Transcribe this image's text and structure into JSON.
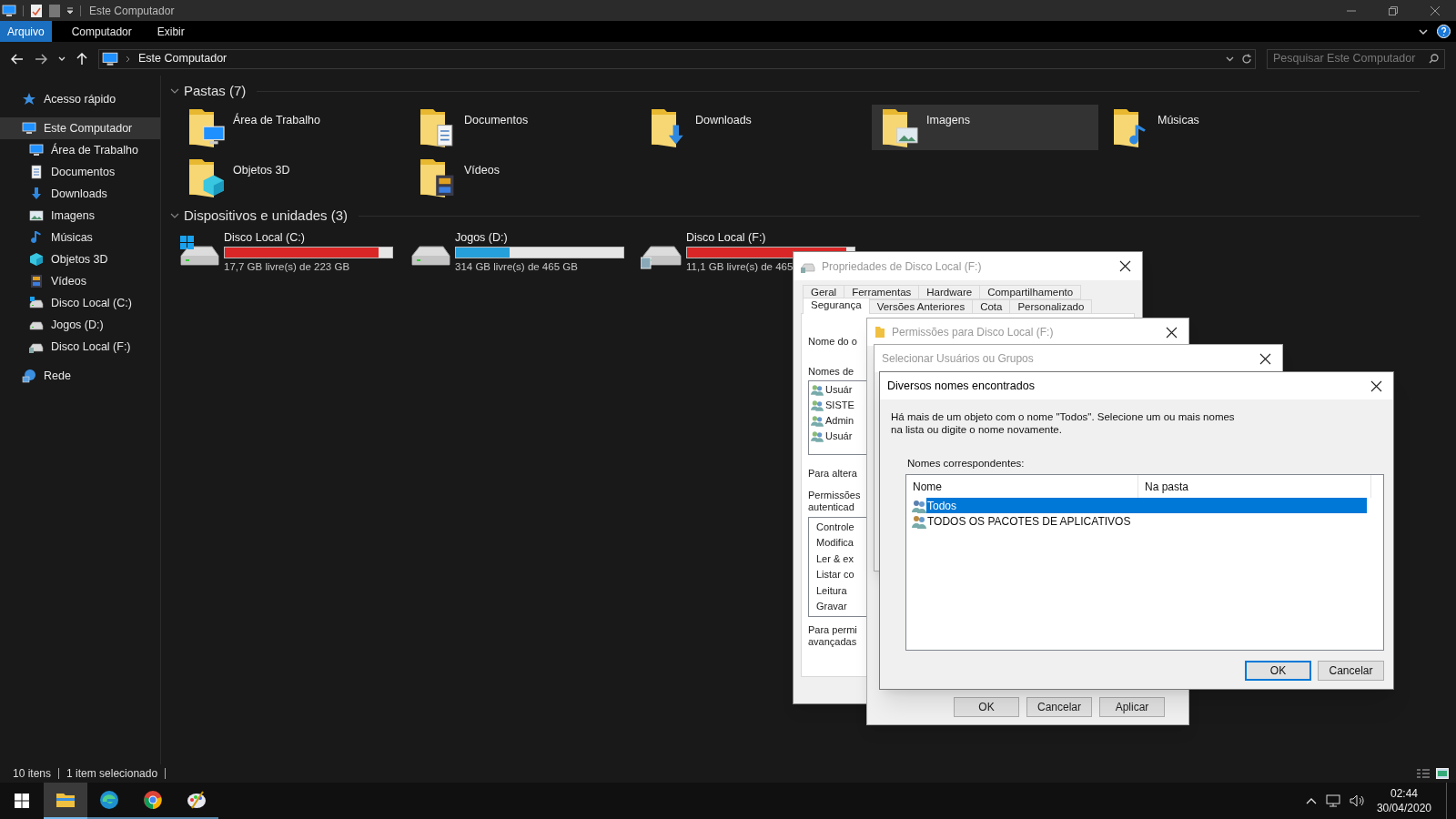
{
  "explorer": {
    "title": "Este Computador",
    "ribbon_tabs": [
      {
        "label": "Arquivo",
        "selected": true
      },
      {
        "label": "Computador",
        "selected": false
      },
      {
        "label": "Exibir",
        "selected": false
      }
    ],
    "address": {
      "path": "Este Computador"
    },
    "search": {
      "placeholder": "Pesquisar Este Computador"
    },
    "sidebar": {
      "items": [
        {
          "label": "Acesso rápido",
          "kind": "star",
          "selected": false
        },
        {
          "label": "Este Computador",
          "kind": "pc",
          "selected": true,
          "children": [
            {
              "label": "Área de Trabalho",
              "kind": "desktop",
              "selected": false
            },
            {
              "label": "Documentos",
              "kind": "documents",
              "selected": false
            },
            {
              "label": "Downloads",
              "kind": "downloads",
              "selected": false
            },
            {
              "label": "Imagens",
              "kind": "pictures",
              "selected": false
            },
            {
              "label": "Músicas",
              "kind": "music",
              "selected": false
            },
            {
              "label": "Objetos 3D",
              "kind": "objects3d",
              "selected": false
            },
            {
              "label": "Vídeos",
              "kind": "videos",
              "selected": false
            },
            {
              "label": "Disco Local (C:)",
              "kind": "drive-windows",
              "selected": false
            },
            {
              "label": "Jogos (D:)",
              "kind": "drive",
              "selected": false
            },
            {
              "label": "Disco Local (F:)",
              "kind": "drive-shared",
              "selected": false
            }
          ]
        },
        {
          "label": "Rede",
          "kind": "network",
          "selected": false
        }
      ]
    },
    "folders_section": {
      "title": "Pastas (7)",
      "expanded": true,
      "folders": [
        {
          "name": "Área de Trabalho",
          "kind": "desktop",
          "selected": false
        },
        {
          "name": "Documentos",
          "kind": "documents",
          "selected": false
        },
        {
          "name": "Downloads",
          "kind": "downloads",
          "selected": false
        },
        {
          "name": "Imagens",
          "kind": "pictures",
          "selected": true
        },
        {
          "name": "Músicas",
          "kind": "music",
          "selected": false
        },
        {
          "name": "Objetos 3D",
          "kind": "objects3d",
          "selected": false
        },
        {
          "name": "Vídeos",
          "kind": "videos",
          "selected": false
        }
      ]
    },
    "drives_section": {
      "title": "Dispositivos e unidades (3)",
      "expanded": true,
      "drives": [
        {
          "name": "Disco Local (C:)",
          "kind": "drive-windows",
          "level": 0.92,
          "free": "17,7 GB livre(s) de 223 GB"
        },
        {
          "name": "Jogos (D:)",
          "kind": "drive",
          "level": 0.32,
          "free": "314 GB livre(s) de 465 GB"
        },
        {
          "name": "Disco Local (F:)",
          "kind": "drive-shared",
          "level": 0.95,
          "free": "11,1 GB livre(s) de 465"
        }
      ]
    },
    "status_bar": {
      "count": "10 itens",
      "selection": "1 item selecionado"
    }
  },
  "properties_dialog": {
    "title": "Propriedades de Disco Local (F:)",
    "tab_rows": [
      [
        {
          "label": "Geral",
          "selected": false
        },
        {
          "label": "Ferramentas",
          "selected": false
        },
        {
          "label": "Hardware",
          "selected": false
        },
        {
          "label": "Compartilhamento",
          "selected": false
        }
      ],
      [
        {
          "label": "Segurança",
          "selected": true
        },
        {
          "label": "Versões Anteriores",
          "selected": false
        },
        {
          "label": "Cota",
          "selected": false
        },
        {
          "label": "Personalizado",
          "selected": false
        }
      ]
    ],
    "object_label": "Nome do o",
    "groups_label": "Nomes de",
    "groups": [
      "Usuár",
      "SISTE",
      "Admin",
      "Usuár"
    ],
    "change_note": "Para altera",
    "permissions_label": [
      "Permissões",
      "autenticad"
    ],
    "permissions": [
      "Controle",
      "Modifica",
      "Ler & ex",
      "Listar co",
      "Leitura",
      "Gravar"
    ],
    "advanced_note": [
      "Para permi",
      "avançadas"
    ]
  },
  "permissions_dialog": {
    "title": "Permissões para Disco Local (F:)",
    "buttons": [
      "OK",
      "Cancelar",
      "Aplicar"
    ]
  },
  "select_dialog": {
    "title": "Selecionar Usuários ou Grupos"
  },
  "names_dialog": {
    "title": "Diversos nomes encontrados",
    "message": "Há mais de um objeto com o nome \"Todos\". Selecione um ou mais nomes na lista ou digite o nome novamente.",
    "list_label": "Nomes correspondentes:",
    "columns": [
      "Nome",
      "Na pasta"
    ],
    "rows": [
      {
        "name": "Todos",
        "selected": true
      },
      {
        "name": "TODOS OS PACOTES DE APLICATIVOS",
        "selected": false
      }
    ],
    "buttons": [
      {
        "label": "OK",
        "default": true
      },
      {
        "label": "Cancelar",
        "default": false
      }
    ]
  },
  "taskbar": {
    "apps": [
      {
        "kind": "explorer",
        "selected": true
      },
      {
        "kind": "edge",
        "selected": false
      },
      {
        "kind": "chrome",
        "selected": false
      },
      {
        "kind": "paint",
        "selected": false
      }
    ],
    "time": "02:44",
    "date": "30/04/2020"
  }
}
